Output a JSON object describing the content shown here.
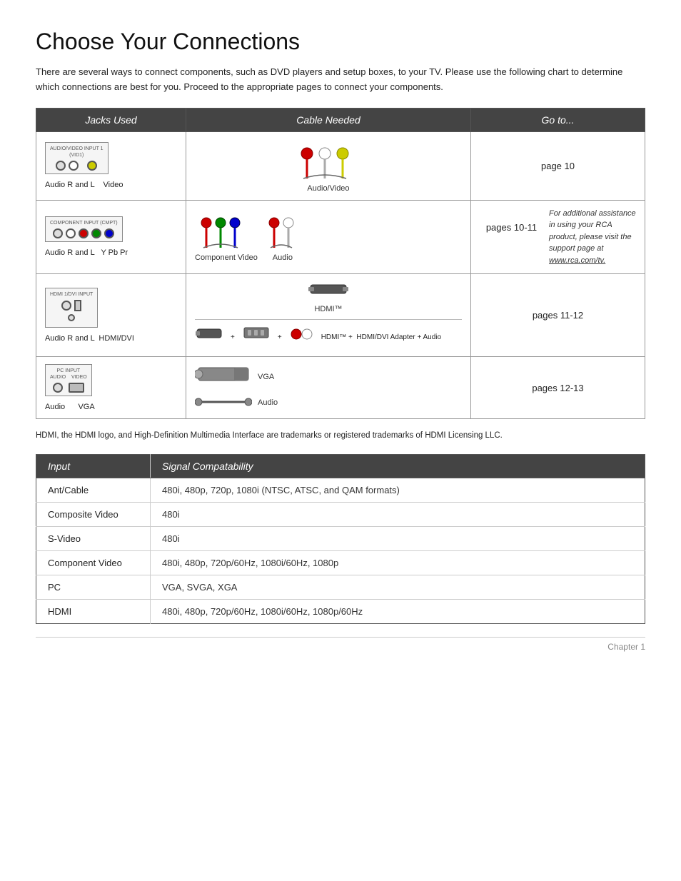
{
  "title": "Choose Your Connections",
  "intro": "There are several ways to connect components, such as DVD players and setup boxes, to your TV. Please use the following chart to determine which connections are best for you. Proceed to the appropriate pages to connect your components.",
  "connections_table": {
    "headers": [
      "Jacks Used",
      "Cable Needed",
      "Go to..."
    ],
    "rows": [
      {
        "jacks_title": "AUDIO/VIDEO INPUT 1 (VID1)",
        "jacks_labels": "Audio R and L    Video",
        "cable_label": "Audio/Video",
        "goto": "page 10",
        "side_note": null
      },
      {
        "jacks_title": "COMPONENT INPUT (CMPT)",
        "jacks_labels": "Audio R and L    Y Pb Pr",
        "cable_label": "Component Video    Audio",
        "goto": "pages 10-11",
        "side_note": "For additional assistance in using your RCA product, please visit the support page at www.rca.com/tv."
      },
      {
        "jacks_title": "HDMI 1/DVI INPUT",
        "jacks_labels": "Audio R and L  HDMI/DVI",
        "cable_label_top": "HDMI™",
        "cable_label_bottom": "HDMI™ +  HDMI/DVI Adapter + Audio",
        "goto": "pages 11-12",
        "side_note": null
      },
      {
        "jacks_title": "PC INPUT",
        "jacks_labels": "Audio    VGA",
        "cable_label_top": "VGA",
        "cable_label_bottom": "Audio",
        "goto": "pages 12-13",
        "side_note": null
      }
    ]
  },
  "hdmi_notice": "HDMI, the HDMI logo, and High-Definition Multimedia Interface are trademarks or registered trademarks of HDMI Licensing LLC.",
  "compat_table": {
    "headers": [
      "Input",
      "Signal Compatability"
    ],
    "rows": [
      {
        "input": "Ant/Cable",
        "signal": "480i, 480p, 720p, 1080i (NTSC, ATSC, and QAM formats)"
      },
      {
        "input": "Composite Video",
        "signal": "480i"
      },
      {
        "input": "S-Video",
        "signal": "480i"
      },
      {
        "input": "Component  Video",
        "signal": "480i, 480p, 720p/60Hz, 1080i/60Hz, 1080p"
      },
      {
        "input": "PC",
        "signal": "VGA, SVGA, XGA"
      },
      {
        "input": "HDMI",
        "signal": "480i, 480p, 720p/60Hz, 1080i/60Hz, 1080p/60Hz"
      }
    ]
  },
  "chapter": "Chapter 1",
  "side_note_url": "www.rca.com/tv."
}
